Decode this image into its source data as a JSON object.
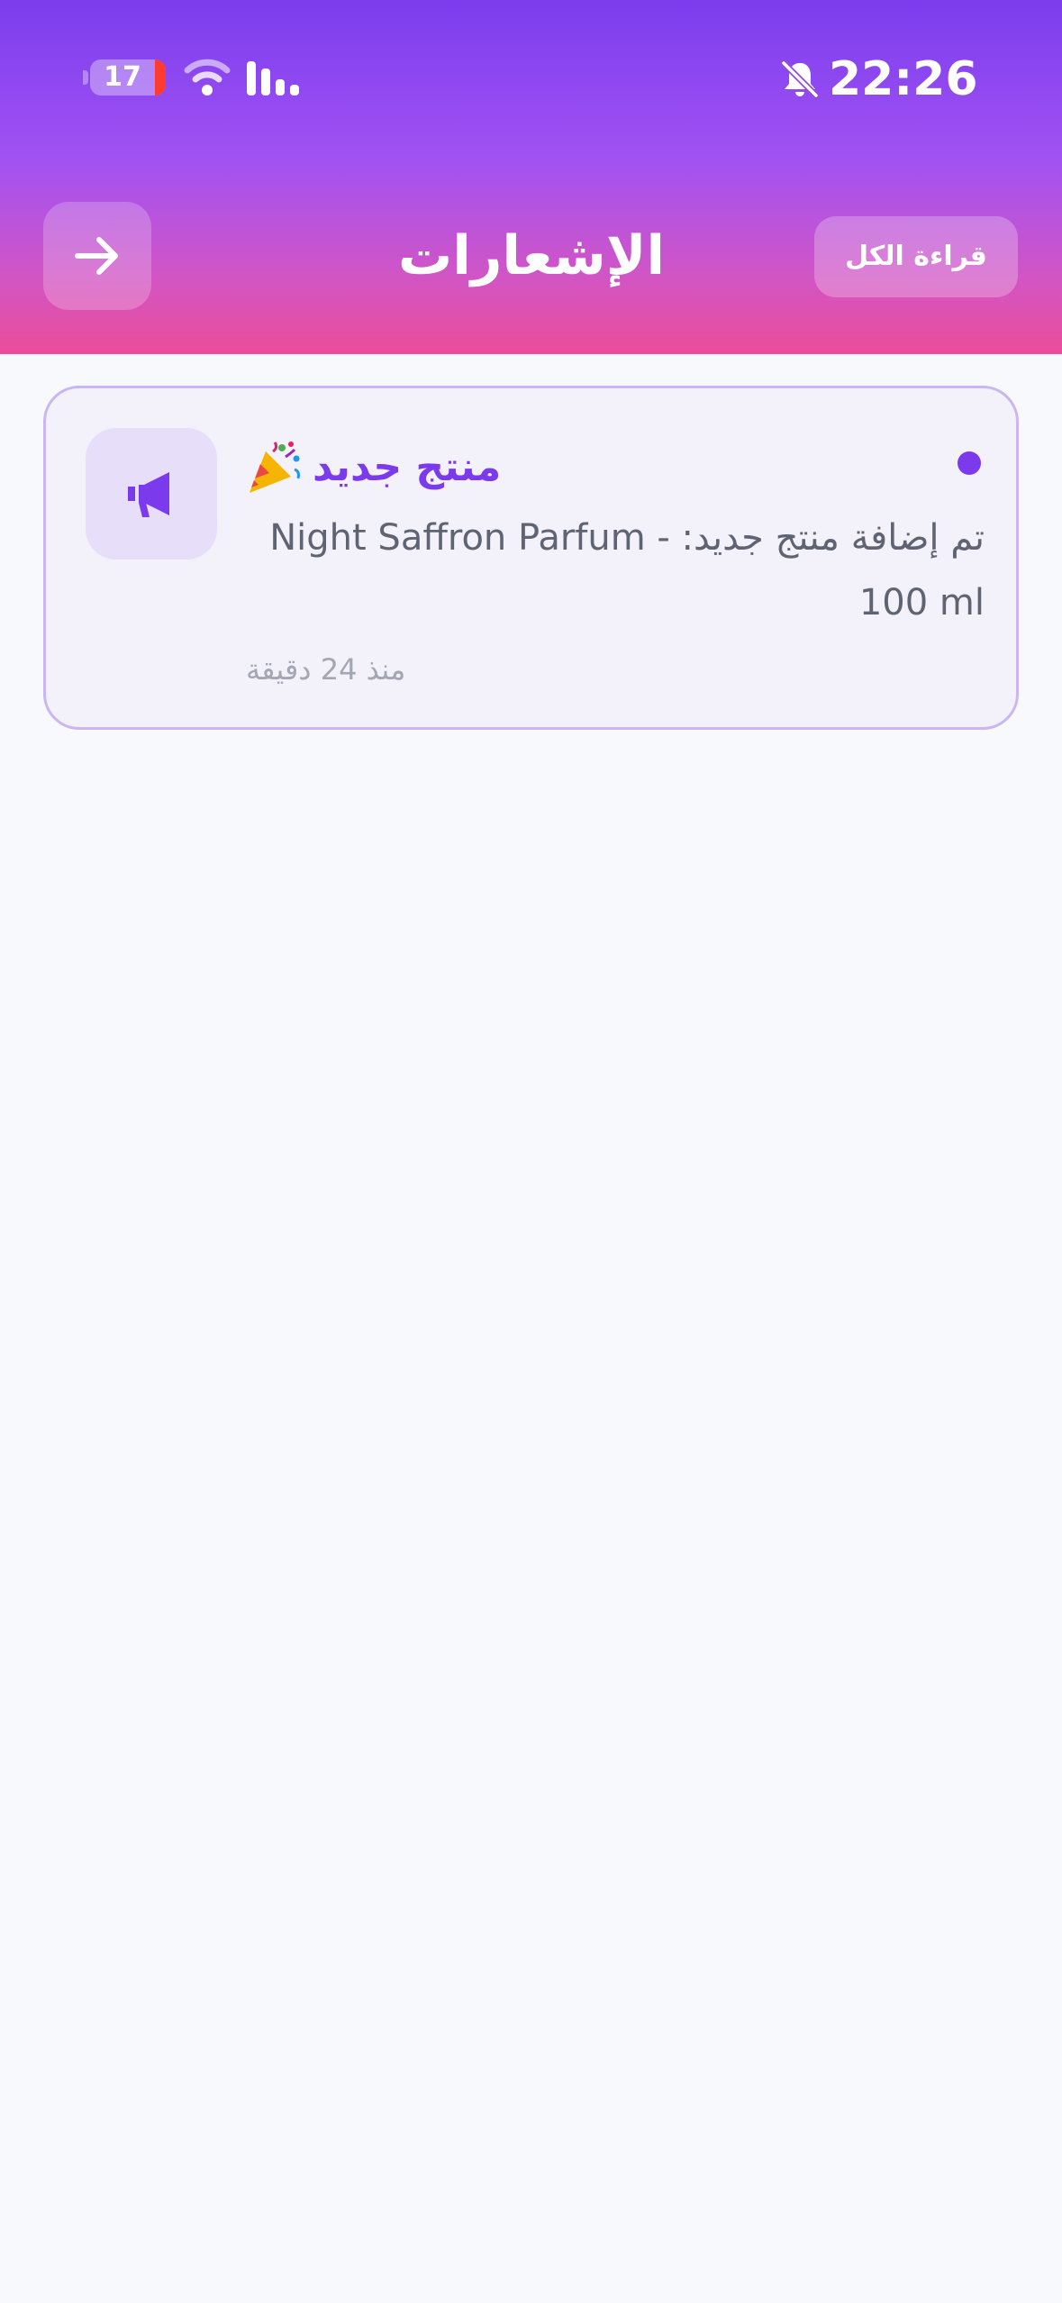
{
  "status_bar": {
    "battery_level": "17",
    "time": "22:26"
  },
  "header": {
    "title": "الإشعارات",
    "read_all_label": "قراءة الكل"
  },
  "notifications": [
    {
      "title": "منتج جديد",
      "message": "تم إضافة منتج جديد: Night Saffron Parfum - 100 ml",
      "time": "منذ 24 دقيقة",
      "unread": true,
      "icon": "megaphone-icon",
      "title_emoji": "party-popper-icon"
    }
  ],
  "colors": {
    "header_gradient_top": "#7b3ded",
    "header_gradient_bottom": "#ec4d99",
    "accent": "#7c3aed",
    "card_border": "#c9b6f2",
    "card_background": "#f3f1f9",
    "page_background": "#f8f9fc"
  }
}
